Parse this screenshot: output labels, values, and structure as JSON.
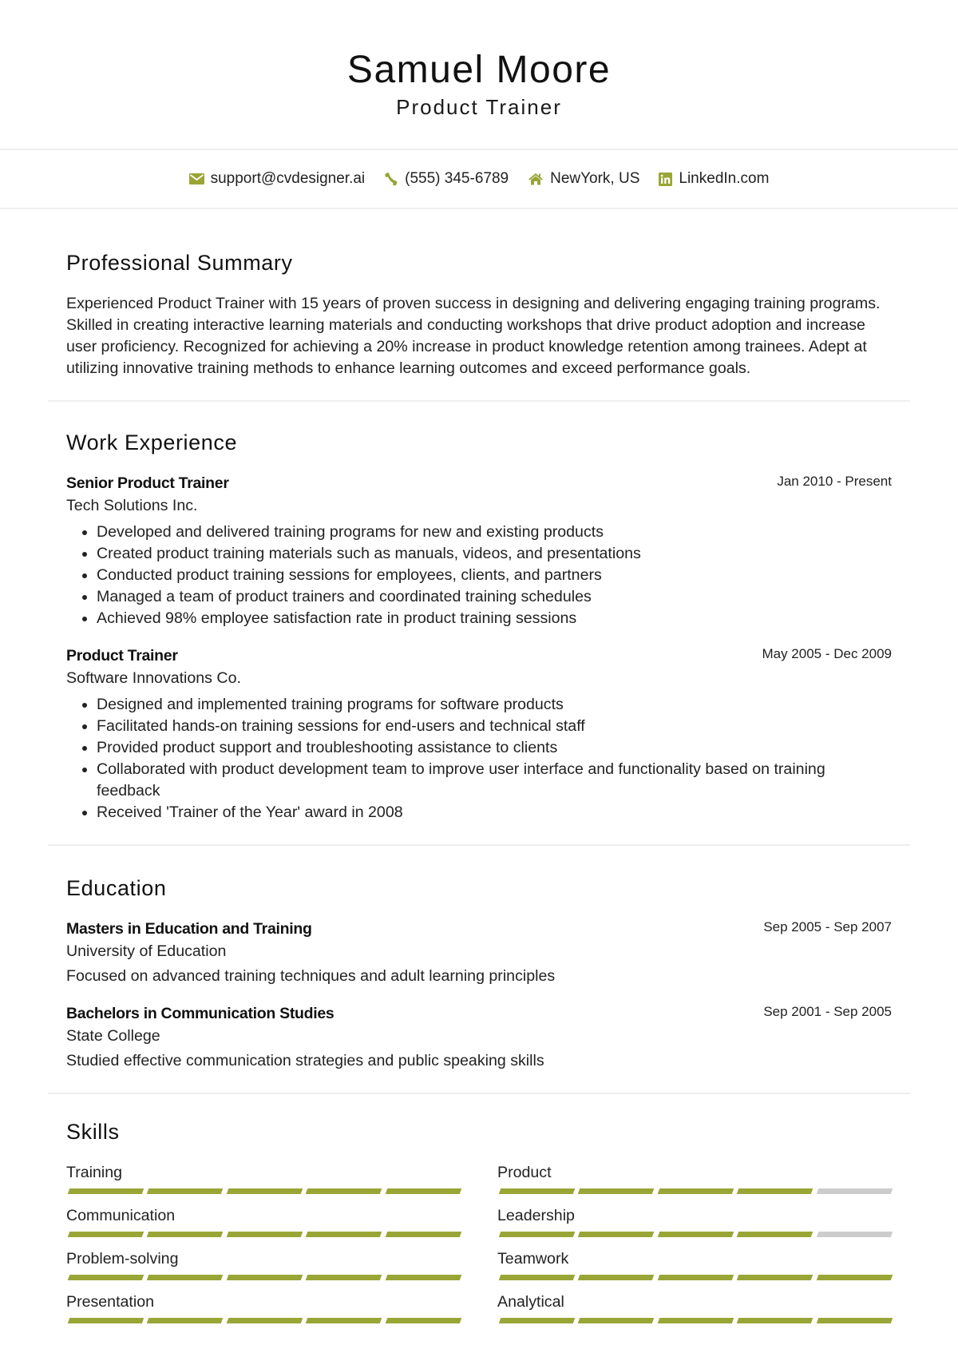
{
  "header": {
    "name": "Samuel Moore",
    "title": "Product Trainer"
  },
  "contact": {
    "accent_color": "#99a535",
    "items": [
      {
        "icon": "envelope-icon",
        "text": "support@cvdesigner.ai"
      },
      {
        "icon": "phone-icon",
        "text": "(555) 345-6789"
      },
      {
        "icon": "home-icon",
        "text": "NewYork, US"
      },
      {
        "icon": "linkedin-icon",
        "text": "LinkedIn.com"
      }
    ]
  },
  "summary": {
    "heading": "Professional Summary",
    "text": "Experienced Product Trainer with 15 years of proven success in designing and delivering engaging training programs. Skilled in creating interactive learning materials and conducting workshops that drive product adoption and increase user proficiency. Recognized for achieving a 20% increase in product knowledge retention among trainees. Adept at utilizing innovative training methods to enhance learning outcomes and exceed performance goals."
  },
  "work": {
    "heading": "Work Experience",
    "jobs": [
      {
        "title": "Senior Product Trainer",
        "company": "Tech Solutions Inc.",
        "dates": "Jan 2010 - Present",
        "bullets": [
          "Developed and delivered training programs for new and existing products",
          "Created product training materials such as manuals, videos, and presentations",
          "Conducted product training sessions for employees, clients, and partners",
          "Managed a team of product trainers and coordinated training schedules",
          "Achieved 98% employee satisfaction rate in product training sessions"
        ]
      },
      {
        "title": "Product Trainer",
        "company": "Software Innovations Co.",
        "dates": "May 2005 - Dec 2009",
        "bullets": [
          "Designed and implemented training programs for software products",
          "Facilitated hands-on training sessions for end-users and technical staff",
          "Provided product support and troubleshooting assistance to clients",
          "Collaborated with product development team to improve user interface and functionality based on training feedback",
          "Received 'Trainer of the Year' award in 2008"
        ]
      }
    ]
  },
  "education": {
    "heading": "Education",
    "entries": [
      {
        "degree": "Masters in Education and Training",
        "school": "University of Education",
        "dates": "Sep 2005 - Sep 2007",
        "description": "Focused on advanced training techniques and adult learning principles"
      },
      {
        "degree": "Bachelors in Communication Studies",
        "school": "State College",
        "dates": "Sep 2001 - Sep 2005",
        "description": "Studied effective communication strategies and public speaking skills"
      }
    ]
  },
  "skills": {
    "heading": "Skills",
    "max_level": 5,
    "items": [
      {
        "name": "Training",
        "level": 5
      },
      {
        "name": "Product",
        "level": 4
      },
      {
        "name": "Communication",
        "level": 5
      },
      {
        "name": "Leadership",
        "level": 4
      },
      {
        "name": "Problem-solving",
        "level": 5
      },
      {
        "name": "Teamwork",
        "level": 5
      },
      {
        "name": "Presentation",
        "level": 5
      },
      {
        "name": "Analytical",
        "level": 5
      }
    ]
  }
}
